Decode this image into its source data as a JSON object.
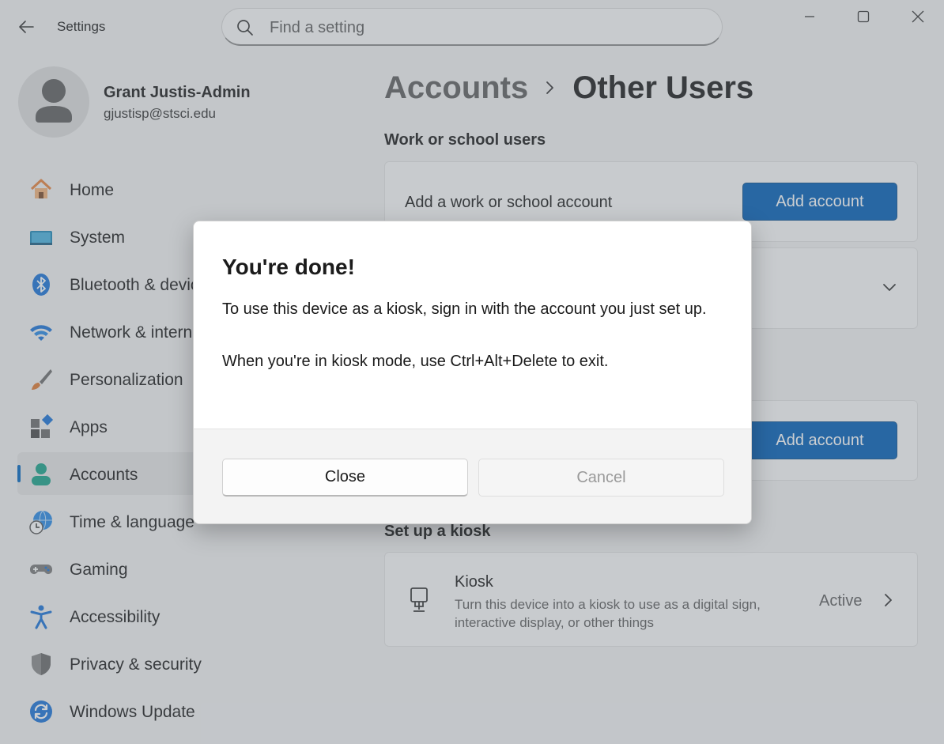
{
  "window": {
    "title": "Settings",
    "search_placeholder": "Find a setting"
  },
  "profile": {
    "name": "Grant Justis-Admin",
    "email": "gjustisp@stsci.edu"
  },
  "sidebar": {
    "items": [
      {
        "label": "Home",
        "icon": "home-icon"
      },
      {
        "label": "System",
        "icon": "system-icon"
      },
      {
        "label": "Bluetooth & devices",
        "icon": "bluetooth-icon"
      },
      {
        "label": "Network & internet",
        "icon": "wifi-icon"
      },
      {
        "label": "Personalization",
        "icon": "brush-icon"
      },
      {
        "label": "Apps",
        "icon": "apps-icon"
      },
      {
        "label": "Accounts",
        "icon": "accounts-icon",
        "selected": true
      },
      {
        "label": "Time & language",
        "icon": "globe-clock-icon"
      },
      {
        "label": "Gaming",
        "icon": "gamepad-icon"
      },
      {
        "label": "Accessibility",
        "icon": "accessibility-icon"
      },
      {
        "label": "Privacy & security",
        "icon": "shield-icon"
      },
      {
        "label": "Windows Update",
        "icon": "update-icon"
      }
    ]
  },
  "breadcrumb": {
    "parent": "Accounts",
    "current": "Other Users"
  },
  "main": {
    "work_section_title": "Work or school users",
    "work_card_text": "Add a work or school account",
    "add_account_label": "Add account",
    "kiosk_section_title": "Set up a kiosk",
    "kiosk": {
      "title": "Kiosk",
      "description": "Turn this device into a kiosk to use as a digital sign, interactive display, or other things",
      "status": "Active"
    }
  },
  "dialog": {
    "title": "You're done!",
    "body_line1": "To use this device as a kiosk, sign in with the account you just set up.",
    "body_line2": "When you're in kiosk mode, use Ctrl+Alt+Delete to exit.",
    "close_label": "Close",
    "cancel_label": "Cancel"
  },
  "colors": {
    "accent": "#005fb8",
    "selection_indicator": "#0067c0"
  }
}
